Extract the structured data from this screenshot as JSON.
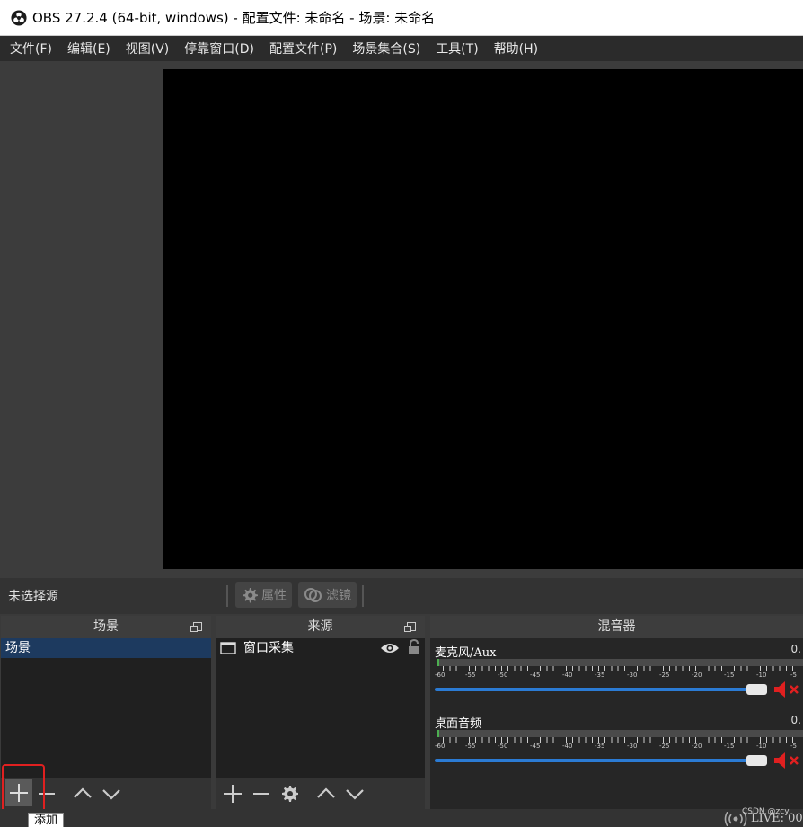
{
  "window": {
    "title": "OBS 27.2.4 (64-bit, windows) - 配置文件: 未命名 - 场景: 未命名"
  },
  "menu": [
    {
      "label": "文件(F)"
    },
    {
      "label": "编辑(E)"
    },
    {
      "label": "视图(V)"
    },
    {
      "label": "停靠窗口(D)"
    },
    {
      "label": "配置文件(P)"
    },
    {
      "label": "场景集合(S)"
    },
    {
      "label": "工具(T)"
    },
    {
      "label": "帮助(H)"
    }
  ],
  "context_bar": {
    "no_source": "未选择源",
    "properties": "属性",
    "filters": "滤镜"
  },
  "scenes": {
    "title": "场景",
    "items": [
      {
        "label": "场景"
      }
    ],
    "tooltip": "添加"
  },
  "sources": {
    "title": "来源",
    "items": [
      {
        "label": "窗口采集"
      }
    ]
  },
  "mixer": {
    "title": "混音器",
    "scale_labels": [
      "-60",
      "-55",
      "-50",
      "-45",
      "-40",
      "-35",
      "-30",
      "-25",
      "-20",
      "-15",
      "-10",
      "-5"
    ],
    "channels": [
      {
        "name": "麦克风/Aux",
        "db": "0."
      },
      {
        "name": "桌面音频",
        "db": "0."
      }
    ]
  },
  "status": {
    "live": "LIVE: 00"
  },
  "watermark": "CSDN @zcy",
  "colors": {
    "accent": "#2b7bd4",
    "selection": "#1d3a5f",
    "mute": "#e02020",
    "highlight": "#e02020"
  }
}
